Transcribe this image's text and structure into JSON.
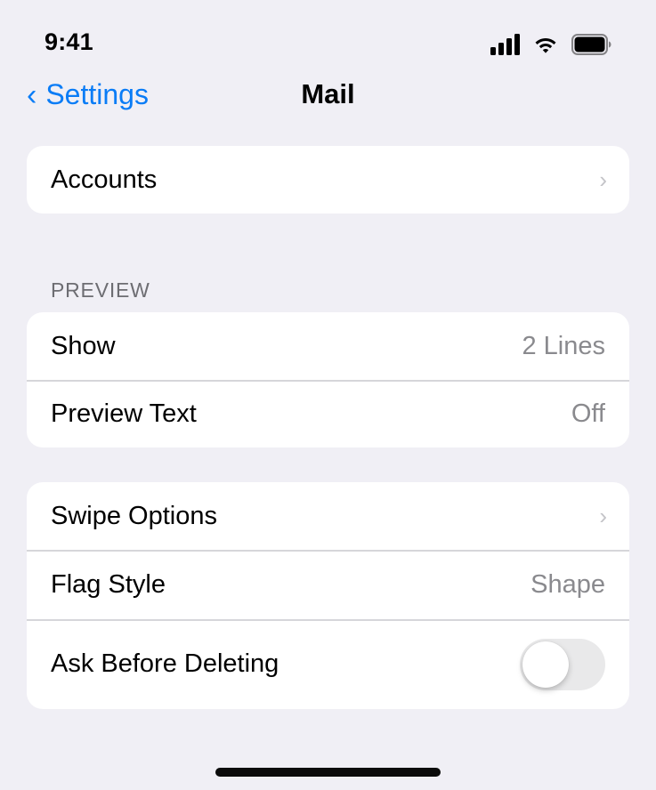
{
  "status_bar": {
    "time": "9:41",
    "icons": [
      "cellular-signal-icon",
      "wifi-icon",
      "battery-icon"
    ]
  },
  "nav": {
    "back_label": "Settings",
    "title": "Mail"
  },
  "groups": {
    "accounts": {
      "label": "Accounts"
    },
    "preview": {
      "header": "PREVIEW",
      "show": {
        "label": "Show",
        "value": "2 Lines"
      },
      "preview_text": {
        "label": "Preview Text",
        "value": "Off"
      }
    },
    "options": {
      "swipe_options": {
        "label": "Swipe Options"
      },
      "flag_style": {
        "label": "Flag Style",
        "value": "Shape"
      },
      "ask_before_deleting": {
        "label": "Ask Before Deleting",
        "enabled": false
      }
    }
  },
  "colors": {
    "accent": "#0a7cf6",
    "background": "#f0eff5",
    "secondary_text": "#8a8a8e"
  }
}
